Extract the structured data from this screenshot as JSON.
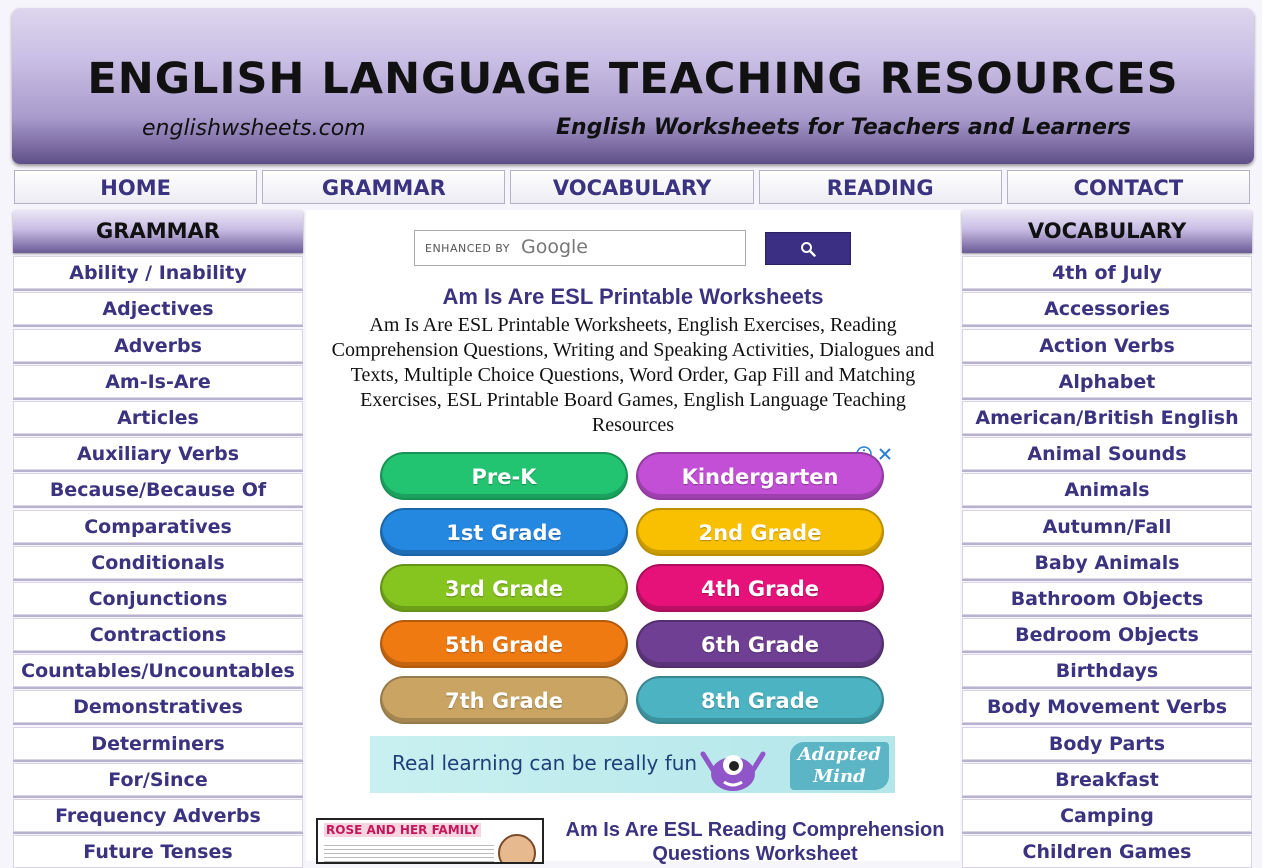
{
  "header": {
    "title": "ENGLISH LANGUAGE TEACHING RESOURCES",
    "domain": "englishwsheets.com",
    "tagline": "English Worksheets for Teachers and Learners"
  },
  "nav": [
    "HOME",
    "GRAMMAR",
    "VOCABULARY",
    "READING",
    "CONTACT"
  ],
  "left_sidebar": {
    "heading": "GRAMMAR",
    "items": [
      "Ability / Inability",
      "Adjectives",
      "Adverbs",
      "Am-Is-Are",
      "Articles",
      "Auxiliary Verbs",
      "Because/Because Of",
      "Comparatives",
      "Conditionals",
      "Conjunctions",
      "Contractions",
      "Countables/Uncountables",
      "Demonstratives",
      "Determiners",
      "For/Since",
      "Frequency Adverbs",
      "Future Tenses"
    ]
  },
  "right_sidebar": {
    "heading": "VOCABULARY",
    "items": [
      "4th of July",
      "Accessories",
      "Action Verbs",
      "Alphabet",
      "American/British English",
      "Animal Sounds",
      "Animals",
      "Autumn/Fall",
      "Baby Animals",
      "Bathroom Objects",
      "Bedroom Objects",
      "Birthdays",
      "Body Movement Verbs",
      "Body Parts",
      "Breakfast",
      "Camping",
      "Children Games"
    ]
  },
  "search": {
    "enhanced_label": "ENHANCED BY",
    "google_label": "Google"
  },
  "main": {
    "title": "Am Is Are ESL Printable Worksheets",
    "description": "Am Is Are ESL Printable Worksheets, English Exercises, Reading Comprehension Questions, Writing and Speaking Activities, Dialogues and Texts, Multiple Choice Questions, Word Order, Gap Fill and Matching Exercises, ESL Printable Board Games, English Language Teaching Resources",
    "article_title": "Am Is Are ESL Reading Comprehension Questions Worksheet",
    "thumb_title": "ROSE AND HER FAMILY"
  },
  "ad": {
    "grades": [
      {
        "label": "Pre-K",
        "color": "#22c472"
      },
      {
        "label": "Kindergarten",
        "color": "#c34fd6"
      },
      {
        "label": "1st Grade",
        "color": "#2487e0"
      },
      {
        "label": "2nd Grade",
        "color": "#f8c000"
      },
      {
        "label": "3rd Grade",
        "color": "#86c41f"
      },
      {
        "label": "4th Grade",
        "color": "#e6127a"
      },
      {
        "label": "5th Grade",
        "color": "#ef7a12"
      },
      {
        "label": "6th Grade",
        "color": "#6f3f93"
      },
      {
        "label": "7th Grade",
        "color": "#c9a463"
      },
      {
        "label": "8th Grade",
        "color": "#4bb3c2"
      }
    ],
    "banner_text": "Real learning can be really fun",
    "banner_logo_top": "Adapted",
    "banner_logo_bottom": "Mind"
  },
  "colors": {
    "brand_purple": "#3b3380",
    "search_button": "#3b2f84"
  }
}
